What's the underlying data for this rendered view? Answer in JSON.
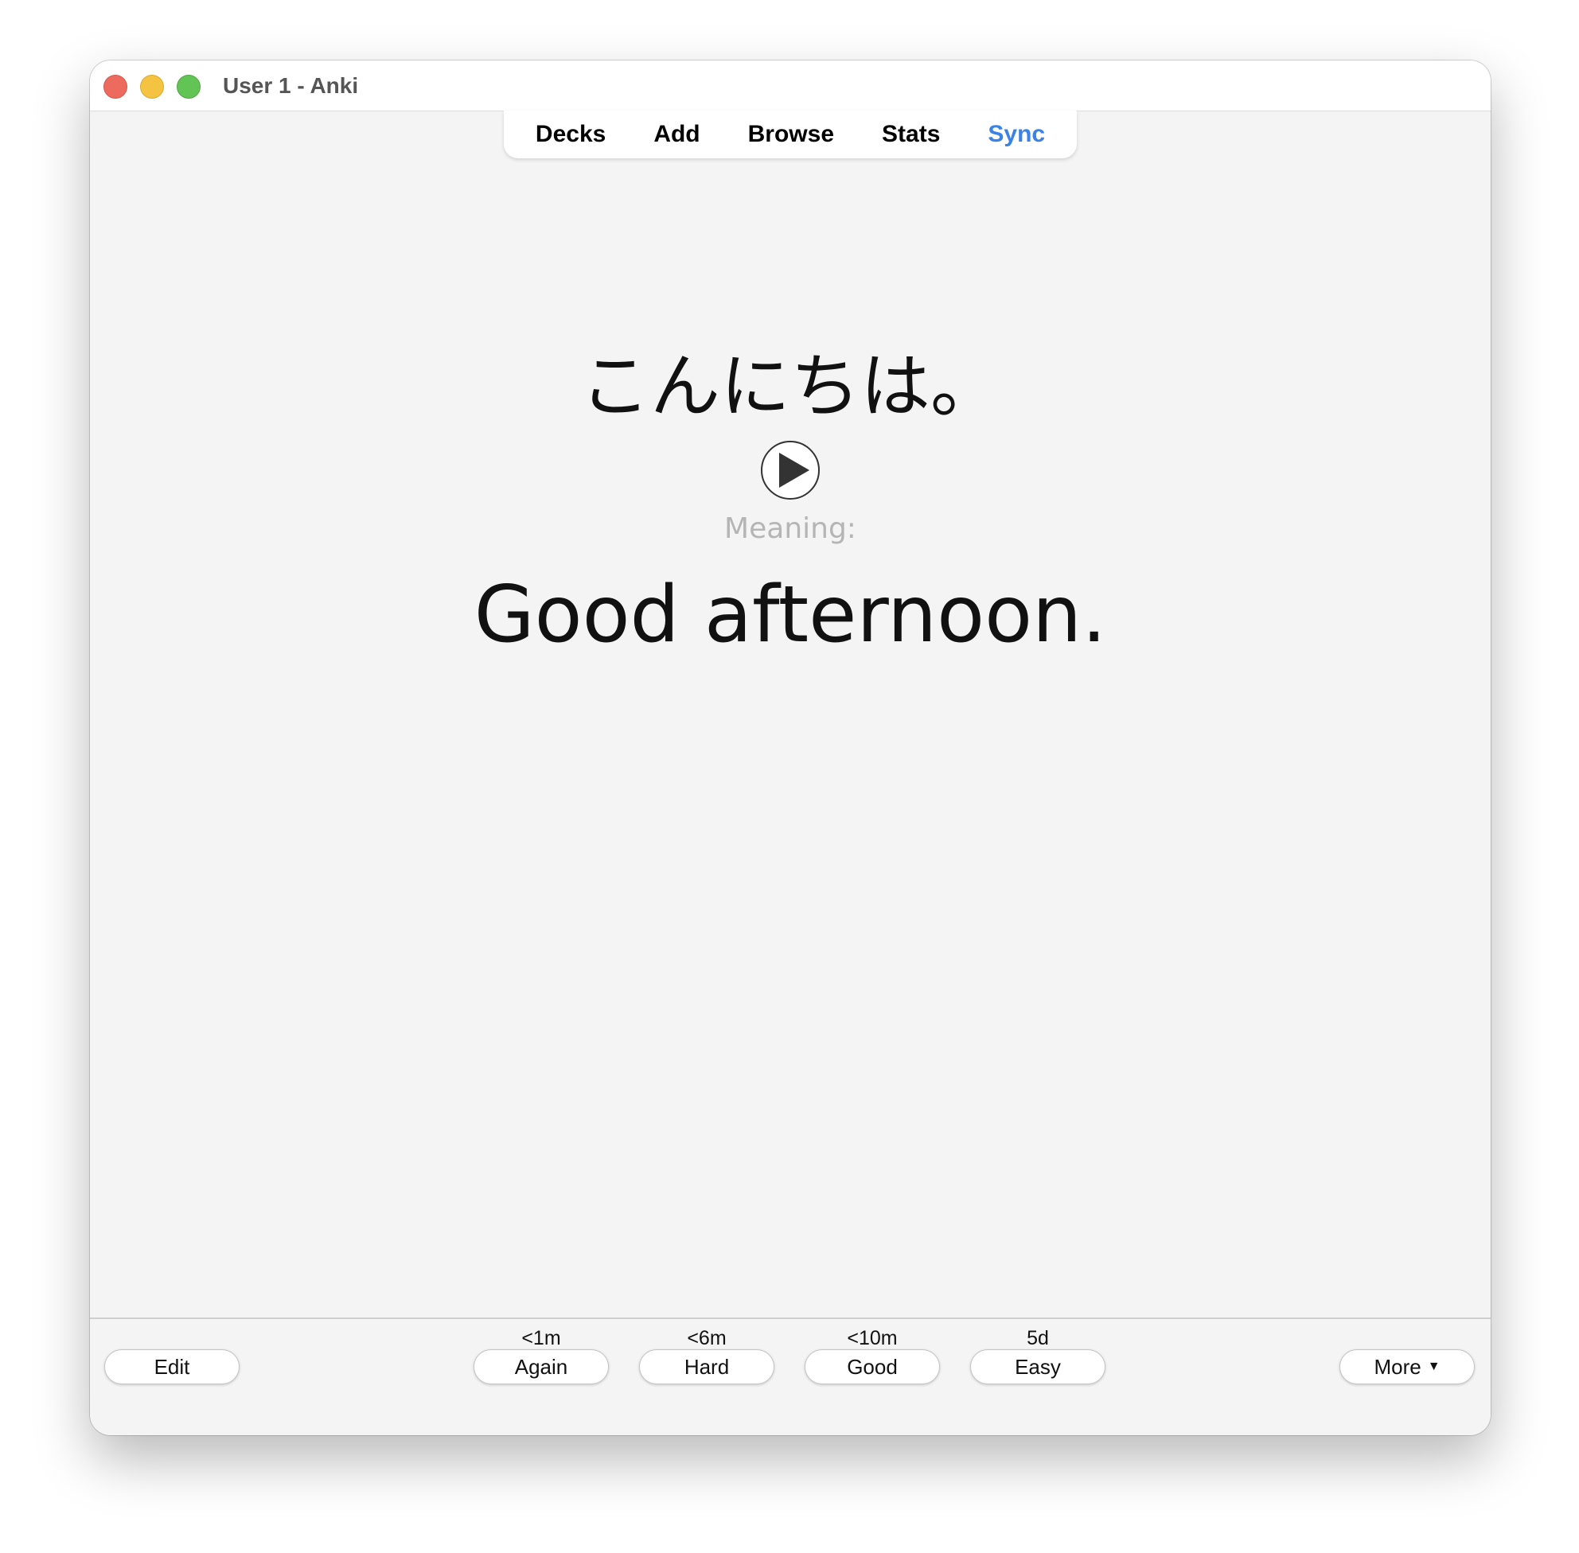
{
  "window": {
    "title": "User 1 - Anki"
  },
  "toolbar": {
    "decks": "Decks",
    "add": "Add",
    "browse": "Browse",
    "stats": "Stats",
    "sync": "Sync",
    "sync_color": "#3b82e8"
  },
  "card": {
    "front": "こんにちは。",
    "play_icon": "play-icon",
    "meaning_label": "Meaning:",
    "back": "Good afternoon."
  },
  "bottom": {
    "edit": "Edit",
    "more": "More",
    "more_icon": "caret-down-icon",
    "answers": {
      "again": {
        "interval": "<1m",
        "label": "Again"
      },
      "hard": {
        "interval": "<6m",
        "label": "Hard"
      },
      "good": {
        "interval": "<10m",
        "label": "Good"
      },
      "easy": {
        "interval": "5d",
        "label": "Easy"
      }
    }
  }
}
